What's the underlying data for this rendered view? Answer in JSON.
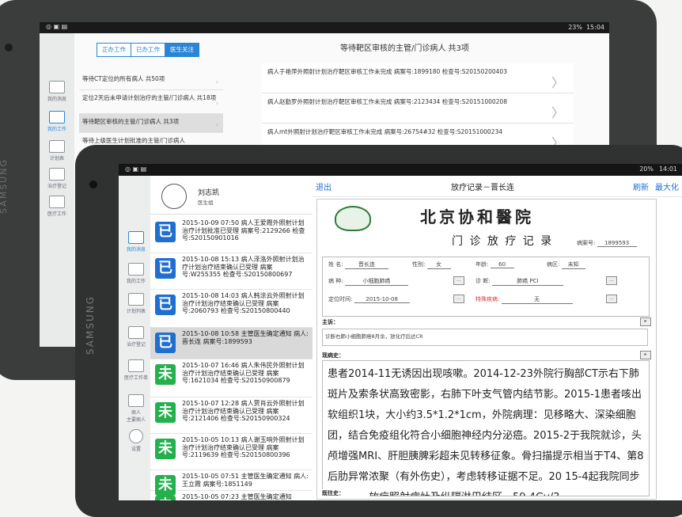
{
  "back_screen": {
    "status_time": "15:04",
    "status_battery": "23%",
    "tabs": [
      {
        "label": "正办工作",
        "active": false
      },
      {
        "label": "已办工作",
        "active": false
      },
      {
        "label": "医生关注",
        "active": true
      }
    ],
    "list_title": "等待靶区审核的主管/门诊病人 共3项",
    "rail": [
      {
        "label": "我的消息"
      },
      {
        "label": "我的工作"
      },
      {
        "label": "计划表"
      },
      {
        "label": "治疗登记"
      },
      {
        "label": "医疗工作"
      }
    ],
    "queues": [
      {
        "label": "等待CT定位的所有病人 共50项",
        "selected": false
      },
      {
        "label": "定位2天后未申请计划治疗的主管/门诊病人 共18项",
        "selected": false
      },
      {
        "label": "等待靶区审核的主管/门诊病人 共3项",
        "selected": true
      },
      {
        "label": "等待上级医生计划批准的主管/门诊病人",
        "selected": false
      }
    ],
    "records": [
      {
        "text": "病人于艳萍外照射计划治疗靶区审核工作未完成 病案号:1899180 检查号:S20150200403"
      },
      {
        "text": "病人赵勤罗外照射计划治疗靶区审核工作未完成 病案号:2123434 检查号:S20151000208"
      },
      {
        "text": "病人mt外照射计划治疗靶区审核工作未完成 病案号:26754#32 检查号:S20151000234"
      }
    ],
    "brand": "SAMSUNG"
  },
  "front_screen": {
    "status_time": "14:01",
    "status_battery": "20%",
    "brand": "SAMSUNG",
    "user_name": "刘志凯",
    "user_role": "医生组",
    "rail": [
      {
        "label": "我的消息"
      },
      {
        "label": "我的工作"
      },
      {
        "label": "计划列表"
      },
      {
        "label": "治疗登记"
      },
      {
        "label": "医疗工作单"
      },
      {
        "label": "病人"
      },
      {
        "label": "主要病人"
      },
      {
        "label": "设置"
      }
    ],
    "messages": [
      {
        "icon": "已",
        "kind": "b",
        "text": "2015-10-09 07:50 病人王爱霞外照射计划治疗计划批准已受理 病案号:2129266 检查号:S20150901016"
      },
      {
        "icon": "已",
        "kind": "b",
        "text": "2015-10-08 15:13 病人泽洛外照射计划治疗计划治疗结束确认已受理 病案号:W255355 检查号:S20150800697"
      },
      {
        "icon": "已",
        "kind": "b",
        "text": "2015-10-08 14:03 病人韩涂云外照射计划治疗计划治疗结束确认已受理 病案号:2060793 检查号:S20150800440"
      },
      {
        "icon": "已",
        "kind": "b",
        "text": "2015-10-08 10:58 主管医生确定通知 病人:晋长连 病案号:1899593",
        "selected": true
      },
      {
        "icon": "未",
        "kind": "g",
        "text": "2015-10-07 16:46 病人朱伟民外照射计划治疗计划治疗结束确认已受理 病案号:1621034 检查号:S20150900879"
      },
      {
        "icon": "未",
        "kind": "g",
        "text": "2015-10-07 12:28 病人贾肖云外照射计划治疗计划治疗结束确认已受理 病案号:2121406 检查号:S20150900324"
      },
      {
        "icon": "未",
        "kind": "g",
        "text": "2015-10-05 10:13 病人谢玉响外照射计划治疗计划治疗结束确认已受理 病案号:2119639 检查号:S20150800396"
      },
      {
        "icon": "未",
        "kind": "g",
        "text": "2015-10-05 07:51 主管医生确定通知 病人:王立霞 病案号:1851149"
      },
      {
        "icon": "未",
        "kind": "g",
        "text": "2015-10-05 07:23 主管医生确定通知"
      }
    ],
    "topbar": {
      "exit": "退出",
      "title": "放疗记录－晋长连",
      "refresh": "刷新",
      "maximize": "最大化"
    },
    "record": {
      "hospital": "北京协和醫院",
      "doc_title": "门 诊 放 疗 记 录",
      "case_label": "病案号:",
      "case_no": "1899593",
      "name_label": "姓  名:",
      "name": "晋长连",
      "sex_label": "性别:",
      "sex": "女",
      "age_label": "年龄:",
      "age": "60",
      "ward_label": "病区:",
      "ward": "未知",
      "disease_label": "病  种:",
      "disease": "小细胞肺癌",
      "diag_label": "诊  断:",
      "diag": "肺癌 PCI",
      "loc_label": "定位时间:",
      "loc_time": "2015-10-08",
      "special_label": "特殊疾病:",
      "special": "无",
      "complaint_label": "主诉：",
      "complaint": "诊断右肺小细胞肺癌8月余，放化疗后达CR",
      "history_label": "现病史：",
      "history": "患者2014-11无诱因出现咳嗽。2014-12-23外院行胸部CT示右下肺斑片及索条状高致密影，右肺下叶支气管内结节影。2015-1患者咳出软组织1块，大小约3.5*1.2*1cm，外院病理：见移略大、深染细胞团，结合免疫组化符合小细胞神经内分泌癌。2015-2于我院就诊，头颅增强MRI、肝胆胰脾彩超未见转移征象。骨扫描提示相当于T4、第8后肋异常浓聚（有外伤史），考虑转移证据不足。20 15-4起我院同步放化疗：放疗照射病灶及纵隔淋巴结区，59.4Gy/3",
      "past_label": "既往史："
    }
  }
}
